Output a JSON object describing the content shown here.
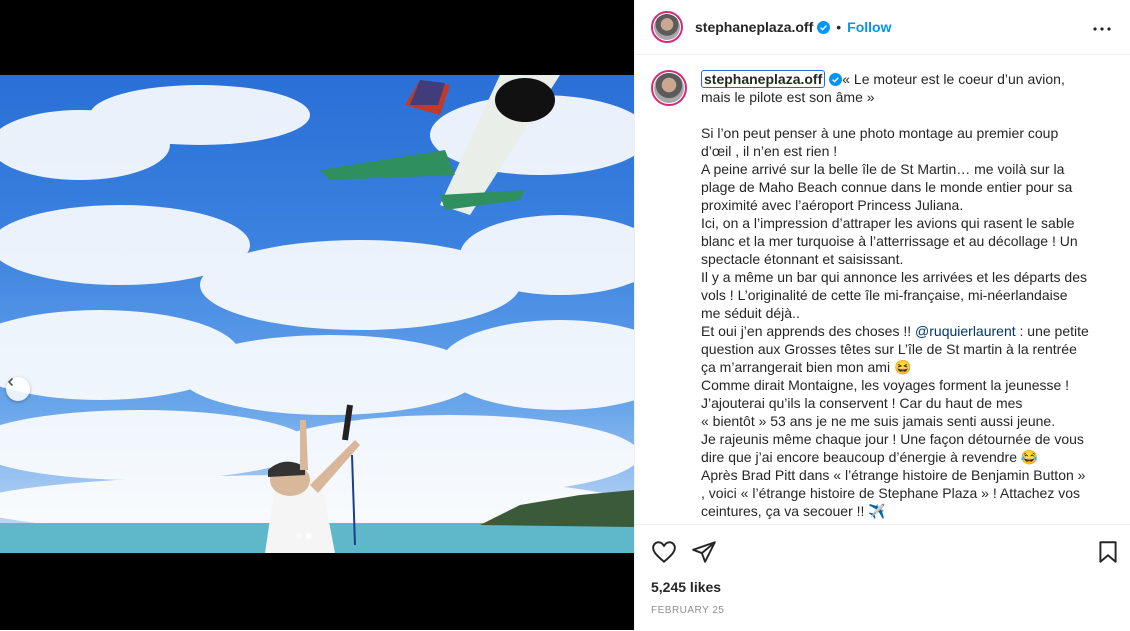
{
  "post": {
    "username": "stephaneplaza.off",
    "follow_label": "Follow",
    "separator": "•",
    "likes": "5,245 likes",
    "date": "FEBRUARY 25",
    "caption_lines": [
      "« Le moteur est le coeur d’un avion,",
      "mais le pilote est son âme »",
      "",
      "Si l’on peut penser à une photo montage au premier coup",
      "d’œil , il n’en est rien !",
      "A peine arrivé sur la belle île de St Martin… me voilà sur la",
      "plage de Maho Beach connue dans le monde entier pour sa",
      "proximité avec l’aéroport Princess Juliana.",
      "Ici, on a l’impression d’attraper les avions qui rasent le sable",
      "blanc et la mer turquoise à l’atterrissage et au décollage ! Un",
      "spectacle étonnant et saisissant.",
      "Il y a même un bar qui annonce les arrivées et les départs des",
      "vols ! L’originalité de cette île mi-française, mi-néerlandaise",
      "me séduit déjà..",
      "Et oui j’en apprends des choses !! ",
      "question aux Grosses têtes sur L’île de St martin à la rentrée",
      "ça m’arrangerait bien mon ami 😆",
      "Comme dirait Montaigne, les voyages forment la jeunesse !",
      "J’ajouterai qu’ils la conservent ! Car du haut de mes",
      "« bientôt » 53 ans je ne me suis jamais senti aussi jeune.",
      "Je rajeunis même chaque jour ! Une façon détournée de vous",
      "dire que j’ai encore beaucoup d’énergie à revendre 😂",
      "Après Brad Pitt dans « l’étrange histoire de Benjamin Button »",
      ", voici « l’étrange histoire de Stephane Plaza » ! Attachez vos",
      "ceintures, ça va secouer !! ✈️"
    ],
    "mention": "@ruquierlaurent",
    "mention_suffix": " : une petite"
  },
  "icons": {
    "verified": "verified-badge-icon",
    "more": "more-options-icon",
    "like": "heart-icon",
    "share": "share-icon",
    "save": "bookmark-icon",
    "prev": "chevron-left-icon"
  },
  "colors": {
    "accent": "#0095f6",
    "verified": "#0095f6",
    "text": "#262626",
    "muted": "#8e8e8e"
  }
}
